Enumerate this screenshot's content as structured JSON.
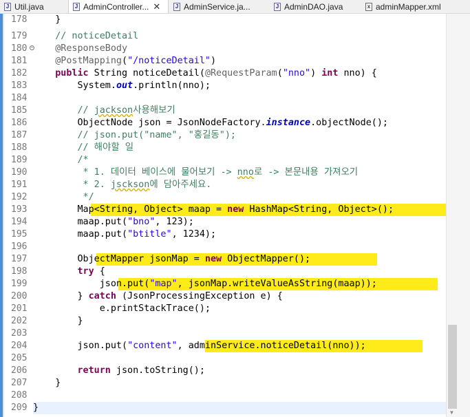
{
  "tabs": [
    {
      "label": "Util.java",
      "icon": "java-file-icon",
      "active": false
    },
    {
      "label": "AdminController...",
      "icon": "java-file-icon",
      "active": true
    },
    {
      "label": "AdminService.ja...",
      "icon": "java-file-icon",
      "active": false
    },
    {
      "label": "AdminDAO.java",
      "icon": "java-file-icon",
      "active": false
    },
    {
      "label": "adminMapper.xml",
      "icon": "xml-file-icon",
      "active": false
    }
  ],
  "close_glyph": "✕",
  "colors": {
    "keyword": "#7f0055",
    "string": "#2a00ff",
    "comment": "#3f7f5f",
    "annotation": "#646464",
    "highlight": "#ffeb1a",
    "current_line": "#e8f2fe"
  },
  "editor": {
    "lines": [
      {
        "num": "178",
        "text": "    }"
      },
      {
        "num": "179",
        "text": "    // noticeDetail"
      },
      {
        "num": "180",
        "text": "    @ResponseBody"
      },
      {
        "num": "181",
        "text": "    @PostMapping(\"/noticeDetail\")"
      },
      {
        "num": "182",
        "text": "    public String noticeDetail(@RequestParam(\"nno\") int nno) {"
      },
      {
        "num": "183",
        "text": "        System.out.println(nno);"
      },
      {
        "num": "184",
        "text": ""
      },
      {
        "num": "185",
        "text": "        // jackson사용해보기"
      },
      {
        "num": "186",
        "text": "        ObjectNode json = JsonNodeFactory.instance.objectNode();"
      },
      {
        "num": "187",
        "text": "        // json.put(\"name\", \"홍길동\");"
      },
      {
        "num": "188",
        "text": "        // 해야할 일"
      },
      {
        "num": "189",
        "text": "        /*"
      },
      {
        "num": "190",
        "text": "         * 1. 데이터 베이스에 물어보기 -> nno로 -> 본문내용 가져오기"
      },
      {
        "num": "191",
        "text": "         * 2. jsckson에 담아주세요."
      },
      {
        "num": "192",
        "text": "         */"
      },
      {
        "num": "193",
        "text": "        Map<String, Object> maap = new HashMap<String, Object>();"
      },
      {
        "num": "194",
        "text": "        maap.put(\"bno\", 123);"
      },
      {
        "num": "195",
        "text": "        maap.put(\"btitle\", 1234);"
      },
      {
        "num": "196",
        "text": ""
      },
      {
        "num": "197",
        "text": "        ObjectMapper jsonMap = new ObjectMapper();"
      },
      {
        "num": "198",
        "text": "        try {"
      },
      {
        "num": "199",
        "text": "            json.put(\"map\", jsonMap.writeValueAsString(maap));"
      },
      {
        "num": "200",
        "text": "        } catch (JsonProcessingException e) {"
      },
      {
        "num": "201",
        "text": "            e.printStackTrace();"
      },
      {
        "num": "202",
        "text": "        }"
      },
      {
        "num": "203",
        "text": ""
      },
      {
        "num": "204",
        "text": "        json.put(\"content\", adminService.noticeDetail(nno));"
      },
      {
        "num": "205",
        "text": ""
      },
      {
        "num": "206",
        "text": "        return json.toString();"
      },
      {
        "num": "207",
        "text": "    }"
      },
      {
        "num": "208",
        "text": ""
      },
      {
        "num": "209",
        "text": "}"
      }
    ]
  }
}
